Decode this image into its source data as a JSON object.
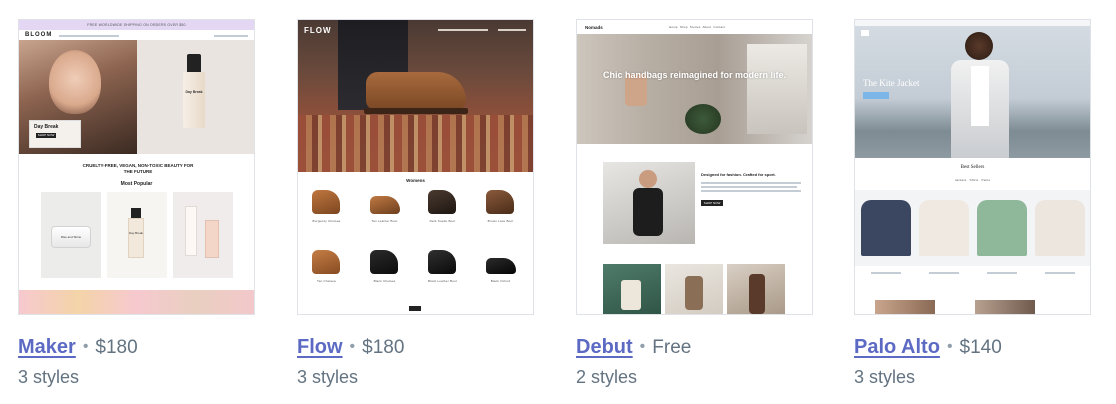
{
  "themes": [
    {
      "name": "Maker",
      "price": "$180",
      "styles": "3 styles",
      "preview": {
        "banner": "FREE WORLDWIDE SHIPPING ON ORDERS OVER $50",
        "logo": "BLOOM",
        "hero_title": "Day Break",
        "hero_button": "SHOP NOW",
        "bottle_label": "Day Break",
        "tagline": "CRUELTY-FREE, VEGAN, NON-TOXIC BEAUTY FOR THE FUTURE",
        "section": "Most Popular",
        "jar_label": "Rise and Shine",
        "bottle2_label": "Day Break",
        "accent_color": "#f4c2c8",
        "banner_color": "#e3d7f3"
      }
    },
    {
      "name": "Flow",
      "price": "$180",
      "styles": "3 styles",
      "preview": {
        "logo": "FLOW",
        "section": "Womens",
        "products": [
          "Burgundy Chelsea",
          "Tan Leather Boot",
          "Dark Suede Boot",
          "Brown Lace Boot",
          "Tan Chelsea",
          "Black Chelsea",
          "Black Leather Boot",
          "Black Oxford"
        ]
      }
    },
    {
      "name": "Debut",
      "price": "Free",
      "styles": "2 styles",
      "preview": {
        "logo": "Nomads",
        "nav": [
          "Home",
          "Shop",
          "Stories",
          "About",
          "Contact"
        ],
        "hero_text": "Chic handbags reimagined for modern life.",
        "feature_title": "Designed for fashion. Crafted for sport.",
        "feature_button": "SHOP NOW"
      }
    },
    {
      "name": "Palo Alto",
      "price": "$140",
      "styles": "3 styles",
      "preview": {
        "hero_title": "The Kite Jacket",
        "section": "Best Sellers",
        "tabs": [
          "Jackets",
          "Shirts",
          "Pants"
        ],
        "shirt_colors": [
          "#3b4661",
          "#efe9e1",
          "#8fb89a",
          "#ece6df"
        ]
      }
    }
  ],
  "separator": "•"
}
